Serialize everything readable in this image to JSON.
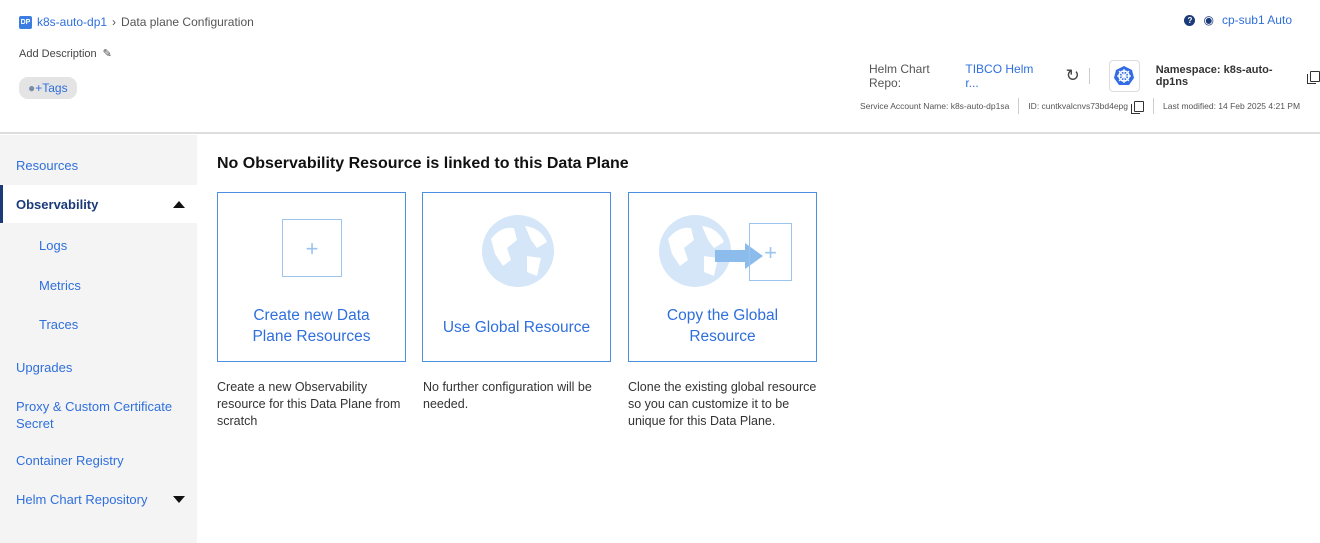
{
  "breadcrumb": {
    "badge": "DP",
    "dataplane": "k8s-auto-dp1",
    "page": "Data plane Configuration"
  },
  "header": {
    "add_description": "Add Description",
    "tags": "+Tags",
    "user": "cp-sub1 Auto",
    "help": "?",
    "helm_label": "Helm Chart Repo:",
    "helm_value": "TIBCO Helm r...",
    "namespace": "Namespace: k8s-auto-dp1ns",
    "service_account": "Service Account Name: k8s-auto-dp1sa",
    "id": "ID: cuntkvalcnvs73bd4epg",
    "last_modified": "Last modified: 14 Feb 2025 4:21 PM"
  },
  "sidebar": {
    "items": [
      "Resources",
      "Observability",
      "Logs",
      "Metrics",
      "Traces",
      "Upgrades",
      "Proxy & Custom Certificate Secret",
      "Container Registry",
      "Helm Chart Repository"
    ]
  },
  "main": {
    "title": "No Observability Resource is linked to this Data Plane",
    "cards": [
      {
        "label": "Create new Data Plane Resources",
        "desc": "Create a new Observability resource for this Data Plane from scratch"
      },
      {
        "label": "Use Global Resource",
        "desc": "No further configuration will be needed."
      },
      {
        "label": "Copy the Global Resource",
        "desc": "Clone the existing global resource so you can customize it to be unique for this Data Plane."
      }
    ]
  }
}
